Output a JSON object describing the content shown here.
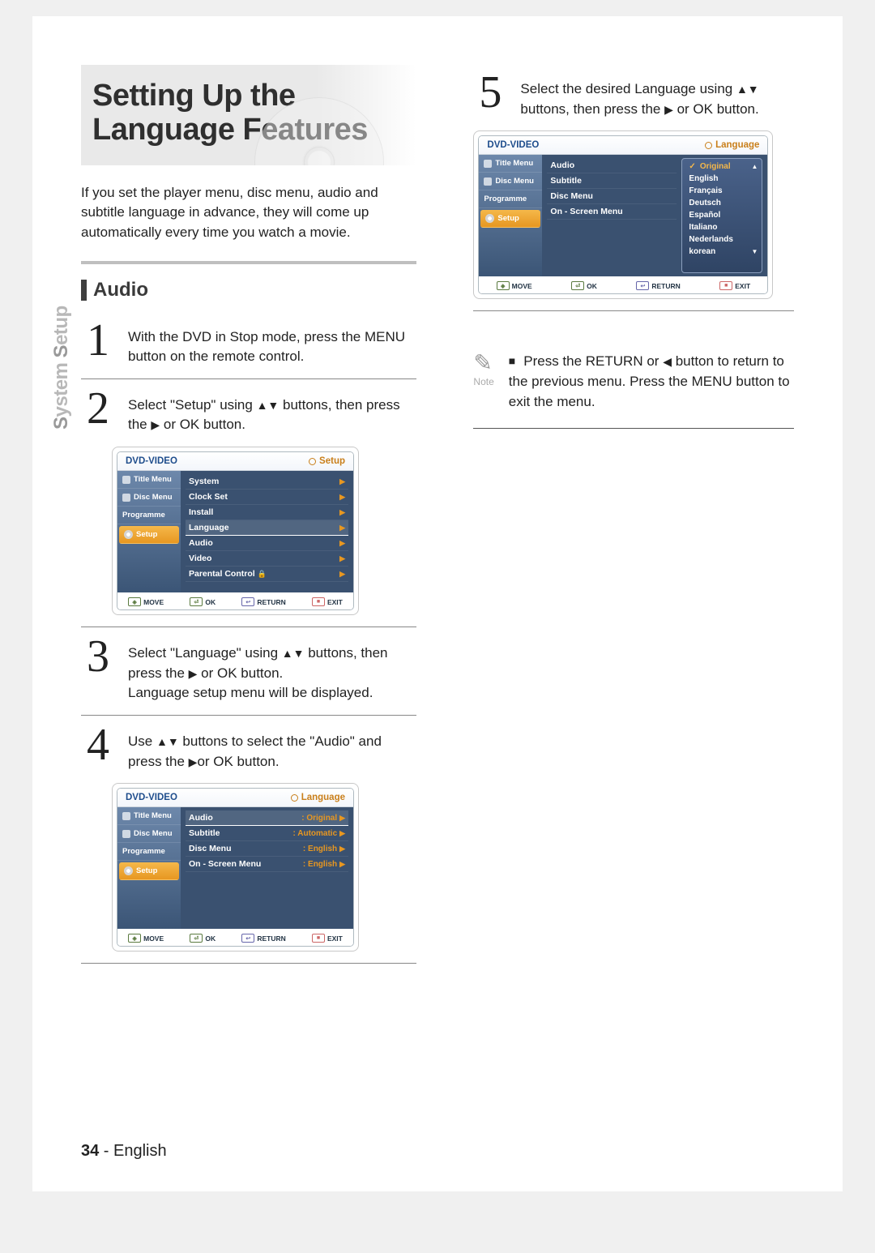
{
  "title": "Setting Up the Language Features",
  "intro": "If  you set the player menu, disc menu, audio and subtitle language in advance, they will come up automatically every time you watch a movie.",
  "sidebar_label_1": "S",
  "sidebar_label_2": "ystem",
  "sidebar_label_3": "S",
  "sidebar_label_4": "etup",
  "section_audio": "Audio",
  "steps": {
    "1": {
      "num": "1",
      "text": "With the DVD in Stop mode, press the MENU button on the remote control."
    },
    "2": {
      "num": "2",
      "text_a": "Select \"Setup\" using ",
      "text_b": " buttons, then press the ",
      "text_c": " or OK button."
    },
    "3": {
      "num": "3",
      "text_a": "Select \"Language\" using ",
      "text_b": " buttons, then press the ",
      "text_c": " or OK button.",
      "text_d": "Language setup menu will be displayed."
    },
    "4": {
      "num": "4",
      "text_a": "Use ",
      "text_b": " buttons to select the \"Audio\" and press the ",
      "text_c": "or OK button."
    },
    "5": {
      "num": "5",
      "text_a": "Select the desired Language using ",
      "text_b": " buttons, then press the ",
      "text_c": " or OK button."
    }
  },
  "osd": {
    "brand": "DVD-VIDEO",
    "label_setup": "Setup",
    "label_language": "Language",
    "side_items": [
      "Title Menu",
      "Disc Menu",
      "Programme",
      "Setup"
    ],
    "setup_rows": [
      "System",
      "Clock Set",
      "Install",
      "Language",
      "Audio",
      "Video",
      "Parental Control"
    ],
    "lang_rows": [
      {
        "k": "Audio",
        "v": ": Original"
      },
      {
        "k": "Subtitle",
        "v": ": Automatic"
      },
      {
        "k": "Disc Menu",
        "v": ": English"
      },
      {
        "k": "On - Screen Menu",
        "v": ": English"
      }
    ],
    "lang_select_rows": [
      "Audio",
      "Subtitle",
      "Disc Menu",
      "On - Screen Menu"
    ],
    "languages": [
      "Original",
      "English",
      "Français",
      "Deutsch",
      "Español",
      "Italiano",
      "Nederlands",
      "korean"
    ],
    "footer": {
      "move": "MOVE",
      "ok": "OK",
      "return": "RETURN",
      "exit": "EXIT"
    }
  },
  "note": {
    "label": "Note",
    "text_a": "Press the RETURN or ",
    "text_b": " button to return to the previous menu. Press the MENU button to exit the menu."
  },
  "footer": {
    "page": "34",
    "sep": " - ",
    "lang": "English"
  },
  "glyphs": {
    "upDown": "▲▼",
    "right": "▶",
    "left": "◀"
  }
}
